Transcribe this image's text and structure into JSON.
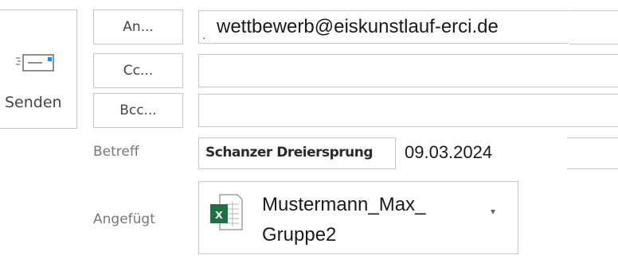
{
  "send": {
    "label": "Senden",
    "icon": "send-envelope-icon"
  },
  "recipients": {
    "to": {
      "button_label": "An...",
      "value": "wettbewerb@eiskunstlauf-erci.de"
    },
    "cc": {
      "button_label": "Cc...",
      "value": ""
    },
    "bcc": {
      "button_label": "Bcc...",
      "value": ""
    }
  },
  "subject": {
    "label": "Betreff",
    "value": "Schanzer Dreiersprung",
    "date": "09.03.2024"
  },
  "attachment": {
    "label": "Angefügt",
    "file_name_line1": "Mustermann_Max_",
    "file_name_line2": "Gruppe2",
    "icon": "excel-file-icon"
  },
  "colors": {
    "border": "#c6c6c6",
    "excel_green": "#1e7145",
    "send_accent": "#2b88d8"
  }
}
